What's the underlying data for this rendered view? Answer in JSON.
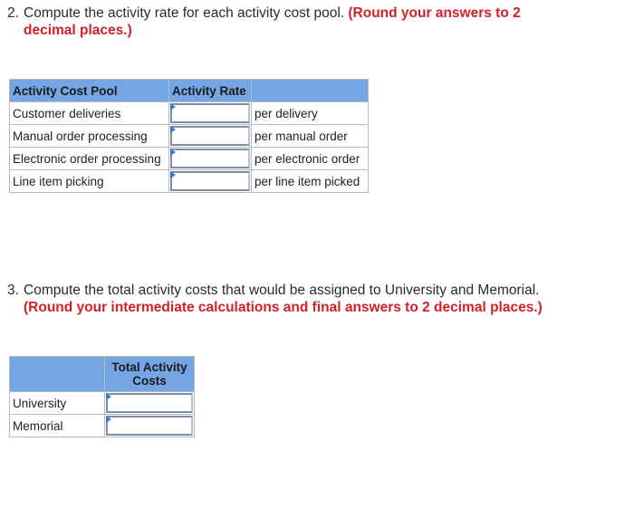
{
  "question2": {
    "number": "2.",
    "text": "Compute the activity rate for each activity cost pool.",
    "instruction_line1": "(Round your answers to 2",
    "instruction_line2": "decimal places.)"
  },
  "table1": {
    "headers": [
      "Activity Cost Pool",
      "Activity Rate",
      ""
    ],
    "rows": [
      {
        "pool": "Customer deliveries",
        "rate_value": "",
        "unit": "per delivery"
      },
      {
        "pool": "Manual order processing",
        "rate_value": "",
        "unit": "per manual order"
      },
      {
        "pool": "Electronic order processing",
        "rate_value": "",
        "unit": "per electronic order"
      },
      {
        "pool": "Line item picking",
        "rate_value": "",
        "unit": "per line item picked"
      }
    ]
  },
  "question3": {
    "number": "3.",
    "text": "Compute the total activity costs that would be assigned to University and Memorial.",
    "instruction": "(Round your intermediate calculations and final answers to 2 decimal places.)"
  },
  "table2": {
    "headers": [
      "",
      "Total Activity Costs"
    ],
    "rows": [
      {
        "label": "University",
        "value": ""
      },
      {
        "label": "Memorial",
        "value": ""
      }
    ]
  },
  "colors": {
    "header_bg": "#74a6e4",
    "instruction_red": "#d3202a",
    "input_flag": "#3a77c9"
  }
}
